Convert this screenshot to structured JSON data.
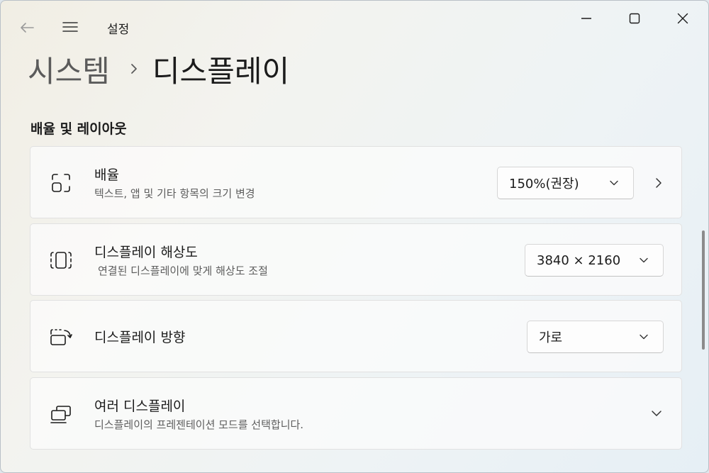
{
  "titlebar": {
    "app_title": "설정",
    "back_icon": "back-arrow-icon",
    "menu_icon": "hamburger-icon"
  },
  "breadcrumb": {
    "parent": "시스템",
    "current": "디스플레이"
  },
  "section": {
    "title": "배율 및 레이아웃"
  },
  "cards": [
    {
      "icon": "scale-icon",
      "title": "배율",
      "description": "텍스트, 앱 및 기타 항목의 크기 변경",
      "control_value": "150%(권장)"
    },
    {
      "icon": "resolution-icon",
      "title": "디스플레이 해상도",
      "description": "연결된 디스플레이에 맞게 해상도 조절",
      "control_value": "3840 × 2160"
    },
    {
      "icon": "orientation-icon",
      "title": "디스플레이 방향",
      "description": "",
      "control_value": "가로"
    },
    {
      "icon": "multiple-displays-icon",
      "title": "여러 디스플레이",
      "description": "디스플레이의 프레젠테이션 모드를 선택합니다.",
      "control_value": ""
    }
  ],
  "colors": {
    "text": "#1b1b1b",
    "secondary_text": "#5d5d5d",
    "card_bg": "#fbfbfb",
    "card_border": "#e1e1e1"
  }
}
